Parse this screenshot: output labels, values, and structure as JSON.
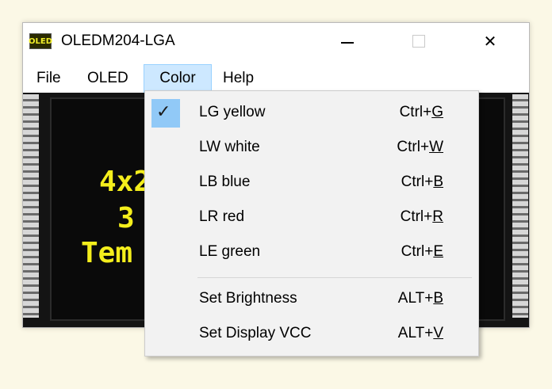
{
  "window": {
    "title": "OLEDM204-LGA",
    "icon_text": "OLED",
    "icon": "oled-app-icon"
  },
  "menubar": {
    "items": [
      {
        "label": "File"
      },
      {
        "label": "OLED"
      },
      {
        "label": "Color"
      },
      {
        "label": "Help"
      }
    ]
  },
  "display": {
    "lines": [
      "4x2",
      "3",
      "Tem"
    ]
  },
  "color_menu": {
    "items": [
      {
        "label": "LG yellow",
        "shortcut_prefix": "Ctrl+",
        "shortcut_key": "G",
        "checked": true
      },
      {
        "label": "LW white",
        "shortcut_prefix": "Ctrl+",
        "shortcut_key": "W",
        "checked": false
      },
      {
        "label": "LB blue",
        "shortcut_prefix": "Ctrl+",
        "shortcut_key": "B",
        "checked": false
      },
      {
        "label": "LR red",
        "shortcut_prefix": "Ctrl+",
        "shortcut_key": "R",
        "checked": false
      },
      {
        "label": "LE green",
        "shortcut_prefix": "Ctrl+",
        "shortcut_key": "E",
        "checked": false
      },
      {
        "label": "Set Brightness",
        "shortcut_prefix": "ALT+",
        "shortcut_key": "B",
        "checked": false
      },
      {
        "label": "Set Display VCC",
        "shortcut_prefix": "ALT+",
        "shortcut_key": "V",
        "checked": false
      }
    ],
    "check_glyph": "✓"
  },
  "colors": {
    "menu_highlight": "#cde8ff",
    "check_highlight": "#91c9f7",
    "oled_text": "#f4ee1c"
  }
}
